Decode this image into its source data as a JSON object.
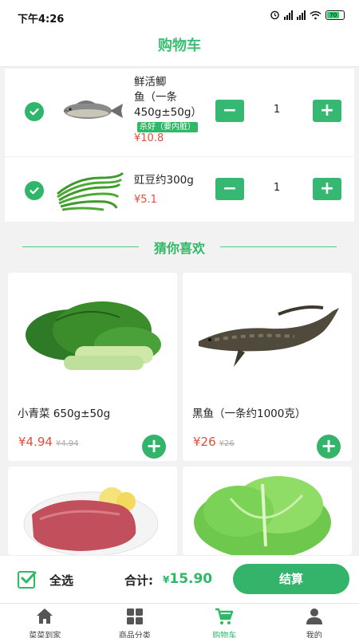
{
  "status_bar": {
    "time": "下午4:26",
    "battery": "70"
  },
  "header": {
    "title": "购物车"
  },
  "cart": {
    "items": [
      {
        "name_line1": "鲜活鲫",
        "name_line2": "鱼（一条",
        "name_line3": "450g±50g）",
        "tag": "杀好（要内脏）",
        "price": "¥10.8",
        "quantity": "1",
        "checked": true
      },
      {
        "name_line1": "豇豆约300g",
        "price": "¥5.1",
        "quantity": "1",
        "checked": true
      }
    ]
  },
  "recommend": {
    "title": "猜你喜欢",
    "items": [
      {
        "name": "小青菜 650g±50g",
        "price": "¥4.94",
        "old_price": "¥4.94"
      },
      {
        "name": "黑鱼（一条约1000克）",
        "price": "¥26",
        "old_price": "¥26"
      },
      {
        "name": "",
        "price": "",
        "old_price": ""
      },
      {
        "name": "",
        "price": "",
        "old_price": ""
      }
    ]
  },
  "bottom_bar": {
    "select_all": "全选",
    "total_label": "合计:",
    "total_currency": "¥",
    "total_value": "15.90",
    "checkout": "结算"
  },
  "tabbar": {
    "items": [
      {
        "label": "菜菜到家",
        "icon": "home-icon"
      },
      {
        "label": "商品分类",
        "icon": "grid-icon"
      },
      {
        "label": "购物车",
        "icon": "cart-icon",
        "active": true
      },
      {
        "label": "我的",
        "icon": "user-icon"
      }
    ]
  },
  "colors": {
    "accent": "#2fb966",
    "price": "#e34d3c"
  }
}
